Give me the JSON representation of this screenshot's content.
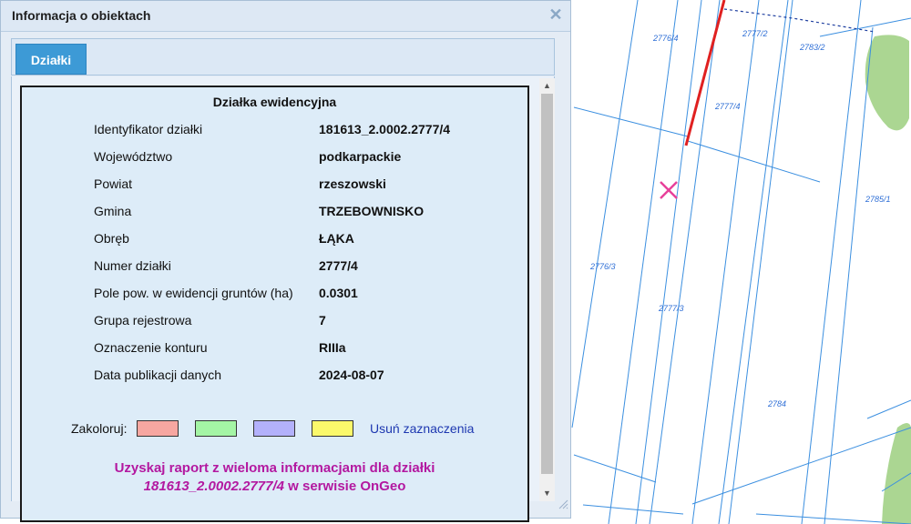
{
  "panel": {
    "title": "Informacja o obiektach",
    "close_icon": "close-icon",
    "tab_label": "Działki"
  },
  "parcel": {
    "heading": "Działka ewidencyjna",
    "rows": [
      {
        "label": "Identyfikator działki",
        "value": "181613_2.0002.2777/4"
      },
      {
        "label": "Województwo",
        "value": "podkarpackie"
      },
      {
        "label": "Powiat",
        "value": "rzeszowski"
      },
      {
        "label": "Gmina",
        "value": "TRZEBOWNISKO"
      },
      {
        "label": "Obręb",
        "value": "ŁĄKA"
      },
      {
        "label": "Numer działki",
        "value": "2777/4"
      },
      {
        "label": "Pole pow. w ewidencji gruntów (ha)",
        "value": "0.0301"
      },
      {
        "label": "Grupa rejestrowa",
        "value": "7"
      },
      {
        "label": "Oznaczenie konturu",
        "value": "RIIIa"
      },
      {
        "label": "Data publikacji danych",
        "value": "2024-08-07"
      }
    ]
  },
  "colorize": {
    "label": "Zakoloruj:",
    "swatches": [
      "#f7a7a1",
      "#a4f5a5",
      "#b3b1fb",
      "#fbf96b"
    ],
    "clear_label": "Usuń zaznaczenia"
  },
  "report": {
    "line1": "Uzyskaj raport z wieloma informacjami dla działki",
    "parcel_id": "181613_2.0002.2777/4",
    "line2_suffix": " w serwisie OnGeo"
  },
  "map": {
    "labels": {
      "l1": "2776/4",
      "l2": "2777/2",
      "l3": "2783/2",
      "l4": "2777/4",
      "l5": "2785/1",
      "l6": "2776/3",
      "l7": "2777/3",
      "l8": "2784"
    },
    "colors": {
      "parcel_line": "#3b8fe0",
      "selected": "#e02020",
      "marker": "#e8409a",
      "green": "#9ccf7f"
    }
  }
}
